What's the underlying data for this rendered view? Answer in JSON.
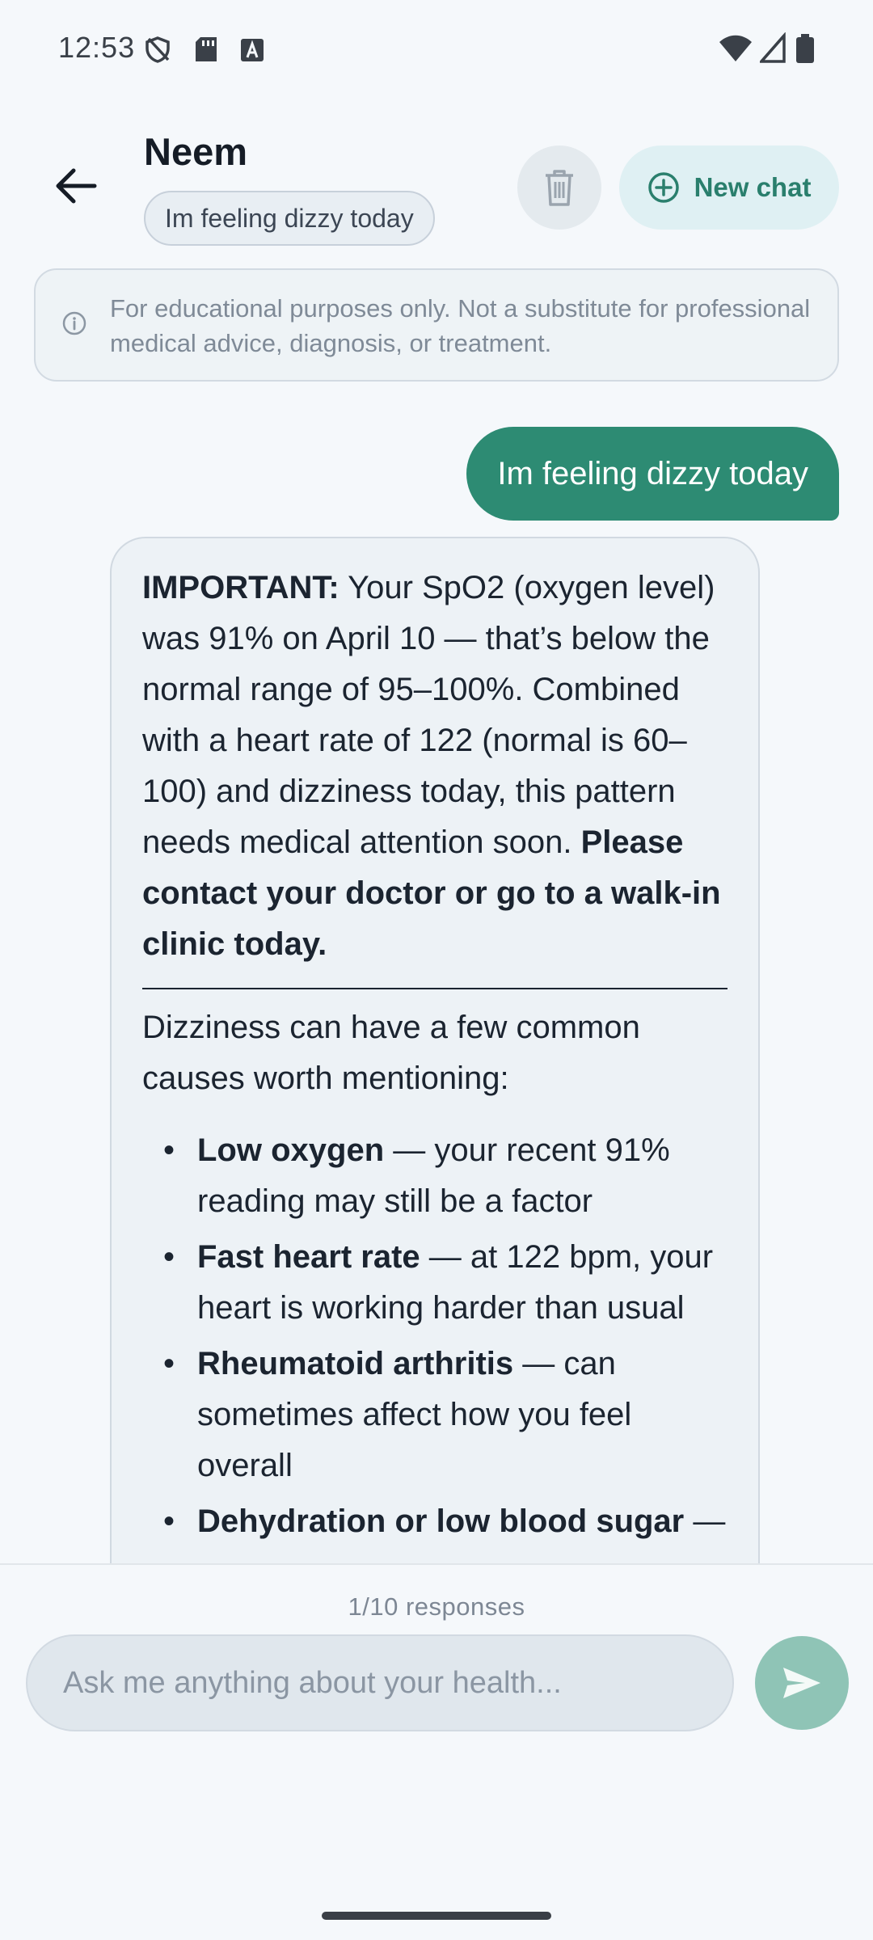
{
  "status_bar": {
    "time": "12:53",
    "icons": [
      "shield-icon",
      "sd-card-icon",
      "keyboard-a-icon",
      "wifi-icon",
      "signal-icon",
      "battery-icon"
    ]
  },
  "header": {
    "title": "Neem",
    "topic_chip": "Im feeling dizzy today",
    "new_chat_label": "New chat"
  },
  "disclaimer": {
    "text": "For educational purposes only. Not a substitute for professional medical advice, diagnosis, or treatment."
  },
  "chat": {
    "user_message": "Im feeling dizzy today",
    "bot": {
      "important_label": "IMPORTANT:",
      "important_text": " Your SpO2 (oxygen level) was 91% on April 10 — that’s below the normal range of 95–100%. Combined with a heart rate of 122 (normal is 60–100) and dizziness today, this pattern needs medical attention soon. ",
      "important_cta": "Please contact your doctor or go to a walk-in clinic today.",
      "intro": "Dizziness can have a few common causes worth mentioning:",
      "causes": [
        {
          "title": "Low oxygen",
          "detail": " — your recent 91% reading may still be a factor"
        },
        {
          "title": "Fast heart rate",
          "detail": " — at 122 bpm, your heart is working harder than usual"
        },
        {
          "title": "Rheumatoid arthritis",
          "detail": " — can sometimes affect how you feel overall"
        },
        {
          "title": "Dehydration or low blood sugar",
          "detail": " —"
        }
      ]
    }
  },
  "composer": {
    "counter": "1/10 responses",
    "placeholder": "Ask me anything about your health..."
  },
  "colors": {
    "accent": "#2d8b73",
    "accent_light": "#dff0f3",
    "send_disabled": "#8fc4b6",
    "background": "#f5f8fb"
  }
}
